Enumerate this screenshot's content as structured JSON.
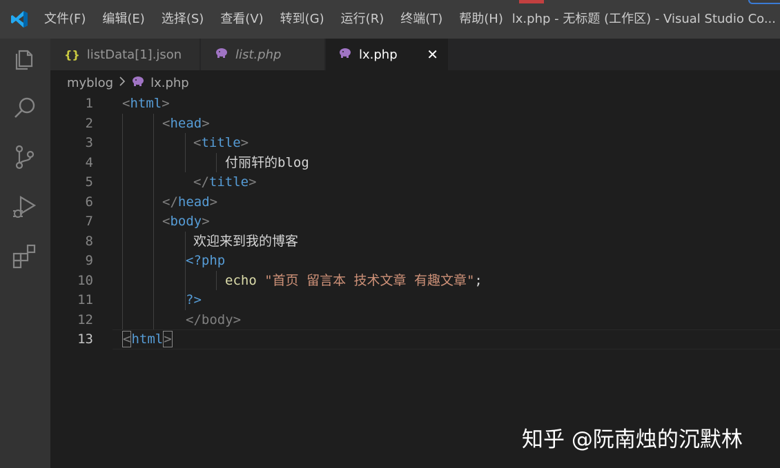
{
  "titlebar": {
    "menu": [
      "文件(F)",
      "编辑(E)",
      "选择(S)",
      "查看(V)",
      "转到(G)",
      "运行(R)",
      "终端(T)",
      "帮助(H)"
    ],
    "window_title": "lx.php - 无标题 (工作区) - Visual Studio Co..."
  },
  "activity": {
    "icons": [
      "explorer-icon",
      "search-icon",
      "source-control-icon",
      "run-debug-icon",
      "extensions-icon"
    ]
  },
  "tabs": [
    {
      "label": "listData[1].json",
      "icon": "json-braces-icon",
      "active": false,
      "italic": false
    },
    {
      "label": "list.php",
      "icon": "php-elephant-icon",
      "active": false,
      "italic": true
    },
    {
      "label": "lx.php",
      "icon": "php-elephant-icon",
      "active": true,
      "italic": false
    }
  ],
  "close_glyph": "✕",
  "breadcrumb": {
    "folder": "myblog",
    "file": "lx.php"
  },
  "editor": {
    "current_line": 13,
    "line_numbers": [
      "1",
      "2",
      "3",
      "4",
      "5",
      "6",
      "7",
      "8",
      "9",
      "10",
      "11",
      "12",
      "13"
    ],
    "lines": {
      "l1_open": "<",
      "l1_name": "html",
      "l1_close": ">",
      "l2_open": "<",
      "l2_name": "head",
      "l2_close": ">",
      "l3_open": "<",
      "l3_name": "title",
      "l3_close": ">",
      "l4_text": "付丽轩的blog",
      "l5_open": "</",
      "l5_name": "title",
      "l5_close": ">",
      "l6_open": "</",
      "l6_name": "head",
      "l6_close": ">",
      "l7_open": "<",
      "l7_name": "body",
      "l7_close": ">",
      "l8_text": "欢迎来到我的博客",
      "l9_php": "<?php",
      "l10_kw": "echo",
      "l10_str": "\"首页 留言本 技术文章 有趣文章\"",
      "l10_end": ";",
      "l11_php": "?>",
      "l12_text": "</body>",
      "l13_open": "<",
      "l13_name": "html",
      "l13_close": ">"
    }
  },
  "watermark": "知乎 @阮南烛的沉默林",
  "colors": {
    "accent": "#007acc",
    "php_icon": "#a074c4",
    "json_icon": "#cbcb41"
  }
}
